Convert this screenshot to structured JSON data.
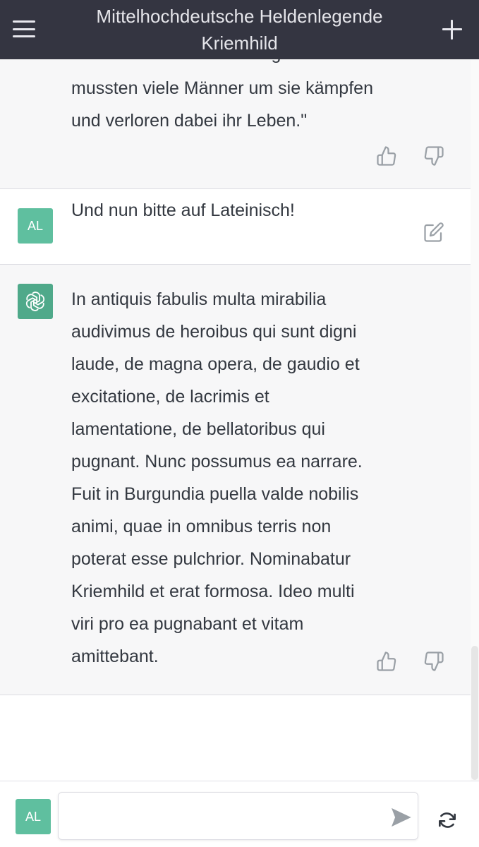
{
  "header": {
    "title": "Mittelhochdeutsche Heldenlegende Kriemhild",
    "menu_icon": "hamburger-menu-icon",
    "new_chat_icon": "plus-icon"
  },
  "messages": [
    {
      "role": "assistant",
      "text_partial_top": "eine schöne Frau. Deswegen",
      "text": "mussten viele Männer um sie kämpfen und verloren dabei ihr Leben.\"",
      "actions": [
        "thumbs-up-icon",
        "thumbs-down-icon"
      ]
    },
    {
      "role": "user",
      "avatar_label": "AL",
      "text": "Und nun bitte auf Lateinisch!",
      "actions": [
        "edit-icon"
      ]
    },
    {
      "role": "assistant",
      "avatar_icon": "openai-logo-icon",
      "text": "In antiquis fabulis multa mirabilia audivimus de heroibus qui sunt digni laude, de magna opera, de gaudio et excitatione, de lacrimis et lamentatione, de bellatoribus qui pugnant. Nunc possumus ea narrare. Fuit in Burgundia puella valde nobilis animi, quae in omnibus terris non poterat esse pulchrior. Nominabatur Kriemhild et erat formosa. Ideo multi viri pro ea pugnabant et vitam amittebant.",
      "actions": [
        "thumbs-up-icon",
        "thumbs-down-icon"
      ]
    }
  ],
  "composer": {
    "avatar_label": "AL",
    "input_value": "",
    "send_icon": "send-icon",
    "regenerate_icon": "refresh-icon"
  },
  "colors": {
    "header_bg": "#343541",
    "assistant_bg": "#f7f7f8",
    "user_avatar": "#5fbf9f",
    "assistant_avatar": "#4fa98a"
  }
}
